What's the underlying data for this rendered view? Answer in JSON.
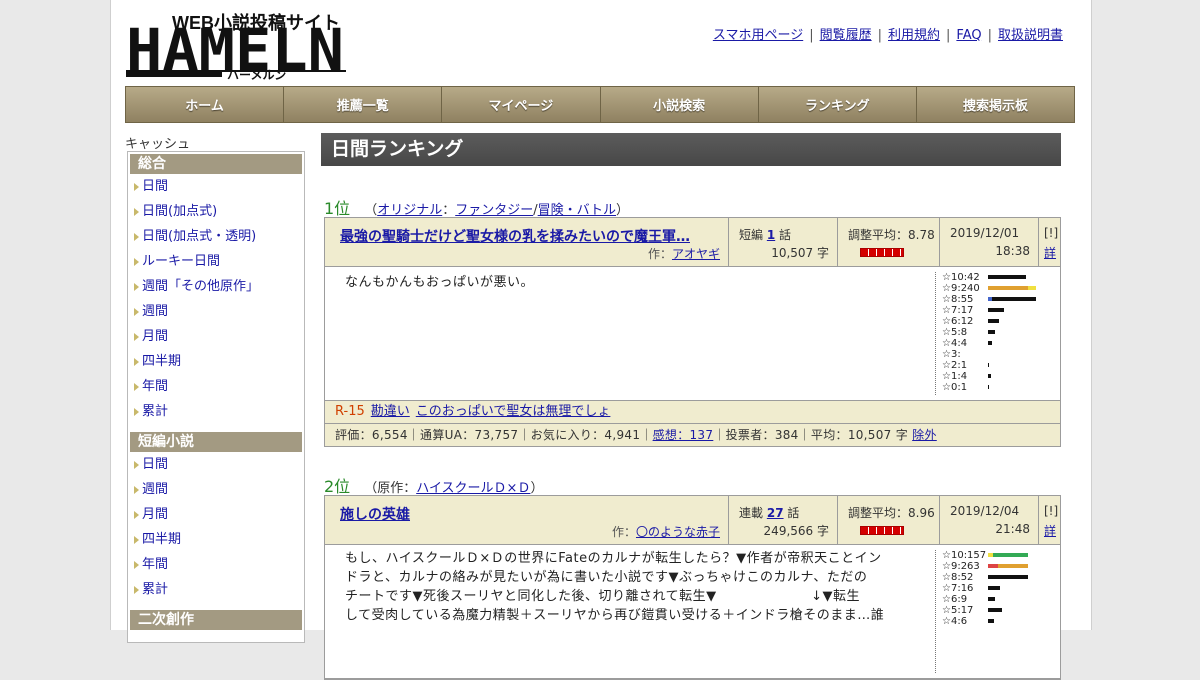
{
  "site": {
    "logo_main": "HAMELN",
    "logo_sub": "WEB小説投稿サイト",
    "logo_kana": "ハーメルン"
  },
  "toplinks": [
    "スマホ用ページ",
    "閲覧履歴",
    "利用規約",
    "FAQ",
    "取扱説明書"
  ],
  "nav": [
    "ホーム",
    "推薦一覧",
    "マイページ",
    "小説検索",
    "ランキング",
    "捜索掲示板"
  ],
  "sidebar": {
    "caption": "キャッシュ",
    "sections": [
      {
        "title": "総合",
        "items": [
          "日間",
          "日間(加点式)",
          "日間(加点式・透明)",
          "ルーキー日間",
          "週間「その他原作」",
          "週間",
          "月間",
          "四半期",
          "年間",
          "累計"
        ]
      },
      {
        "title": "短編小説",
        "items": [
          "日間",
          "週間",
          "月間",
          "四半期",
          "年間",
          "累計"
        ]
      },
      {
        "title": "二次創作",
        "items": []
      }
    ]
  },
  "main": {
    "heading": "日間ランキング",
    "entries": [
      {
        "rank": "1位",
        "genre_open": "（",
        "genre_1": "オリジナル",
        "genre_sep": "：",
        "genre_2": "ファンタジー",
        "genre_slash": "/",
        "genre_3": "冒険・バトル",
        "genre_close": "）",
        "title": "最強の聖騎士だけど聖女様の乳を揉みたいので魔王軍…",
        "author_prefix": "作：",
        "author": "アオヤギ",
        "type_label": "短編",
        "episodes": "1",
        "ep_suffix": "話",
        "chars": "10,507 字",
        "avg_label": "調整平均：8.78",
        "date": "2019/12/01",
        "time": "18:38",
        "flag": "[!]",
        "detail": "詳",
        "synopsis": "なんもかんもおっぱいが悪い。",
        "dist_labels": [
          "☆10:42",
          "☆9:240",
          "☆8:55",
          "☆7:17",
          "☆6:12",
          "☆5:8",
          "☆4:4",
          "☆3:",
          "☆2:1",
          "☆1:4",
          "☆0:1"
        ],
        "dist_bars": [
          [
            {
              "w": 38,
              "c": "#111111"
            }
          ],
          [
            {
              "w": 40,
              "c": "#e0a030"
            },
            {
              "w": 8,
              "c": "#f0e040"
            }
          ],
          [
            {
              "w": 4,
              "c": "#4466cc"
            },
            {
              "w": 44,
              "c": "#111111"
            }
          ],
          [
            {
              "w": 16,
              "c": "#111111"
            }
          ],
          [
            {
              "w": 11,
              "c": "#111111"
            }
          ],
          [
            {
              "w": 7,
              "c": "#111111"
            }
          ],
          [
            {
              "w": 4,
              "c": "#111111"
            }
          ],
          [],
          [
            {
              "w": 1,
              "c": "#111111"
            }
          ],
          [
            {
              "w": 3,
              "c": "#111111"
            }
          ],
          [
            {
              "w": 1,
              "c": "#111111"
            }
          ]
        ],
        "tags_rating": "R-15",
        "tags": [
          "勘違い",
          "このおっぱいで聖女は無理でしょ"
        ],
        "stats_1": "評価：6,554｜通算UA：73,757｜お気に入り：4,941｜",
        "stats_link": "感想：137",
        "stats_2": "｜投票者：384｜平均：10,507 字",
        "stats_exclude": "除外"
      },
      {
        "rank": "2位",
        "genre_open": "（原作：",
        "genre_1": "ハイスクールＤ×Ｄ",
        "genre_close": "）",
        "title": "施しの英雄",
        "author_prefix": "作：",
        "author": "〇のような赤子",
        "type_label": "連載",
        "episodes": "27",
        "ep_suffix": "話",
        "chars": "249,566 字",
        "avg_label": "調整平均：8.96",
        "date": "2019/12/04",
        "time": "21:48",
        "flag": "[!]",
        "detail": "詳",
        "synopsis_lines": [
          "もし、ハイスクールＤ×Ｄの世界にFateのカルナが転生したら？▼作者が帝釈天ことイン",
          "ドラと、カルナの絡みが見たいが為に書いた小説です▼ぶっちゃけこのカルナ、ただの",
          "チートです▼死後スーリヤと同化した後、切り離されて転生▼　　　　　　　↓▼転生",
          "して受肉している為魔力精製＋スーリヤから再び鎧貫い受ける＋インドラ槍そのまま…誰"
        ],
        "dist_labels": [
          "☆10:157",
          "☆9:263",
          "☆8:52",
          "☆7:16",
          "☆6:9",
          "☆5:17",
          "☆4:6"
        ],
        "dist_bars": [
          [
            {
              "w": 5,
              "c": "#f0e040"
            },
            {
              "w": 35,
              "c": "#33aa55"
            }
          ],
          [
            {
              "w": 10,
              "c": "#dd4444"
            },
            {
              "w": 30,
              "c": "#e0a030"
            }
          ],
          [
            {
              "w": 40,
              "c": "#111111"
            }
          ],
          [
            {
              "w": 12,
              "c": "#111111"
            }
          ],
          [
            {
              "w": 7,
              "c": "#111111"
            }
          ],
          [
            {
              "w": 14,
              "c": "#111111"
            }
          ],
          [
            {
              "w": 6,
              "c": "#111111"
            }
          ]
        ]
      }
    ]
  }
}
